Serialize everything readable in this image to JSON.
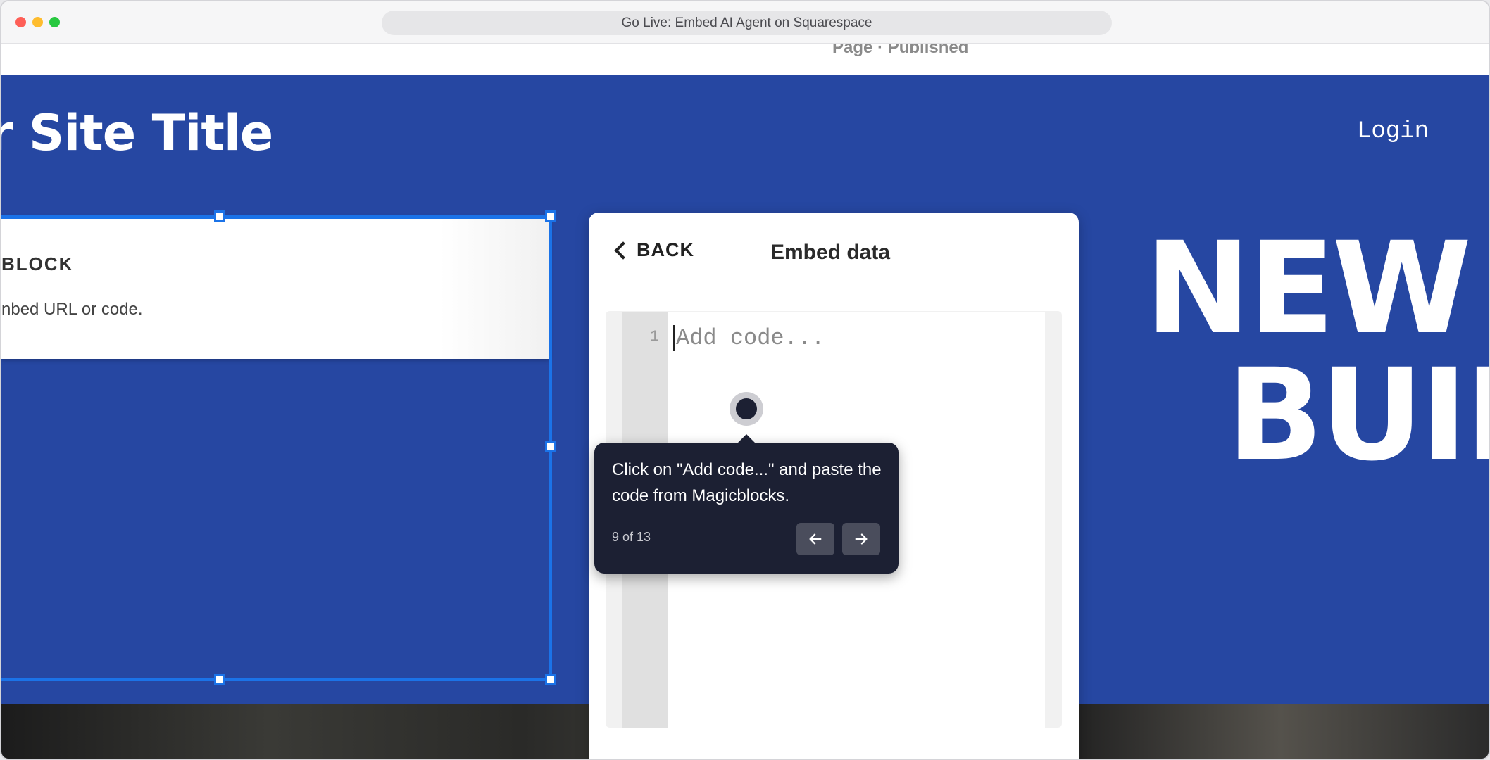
{
  "window": {
    "title": "Go Live: Embed AI Agent on Squarespace"
  },
  "page": {
    "status": "Page · Published"
  },
  "site": {
    "title": "r Site Title",
    "login_label": "Login",
    "hero_line1": "NEW",
    "hero_line2": "BUII"
  },
  "block": {
    "heading": "BLOCK",
    "subtitle": "nbed URL or code."
  },
  "panel": {
    "back_label": "BACK",
    "title": "Embed data",
    "editor": {
      "line_number": "1",
      "placeholder": "Add code..."
    }
  },
  "tour": {
    "text": "Click on \"Add code...\" and paste the code from Magicblocks.",
    "step": "9 of 13",
    "prev_icon": "arrow-left-icon",
    "next_icon": "arrow-right-icon"
  },
  "colors": {
    "hero_blue": "#2647a2",
    "selection_blue": "#1b73e8",
    "tooltip_bg": "#1c2033"
  }
}
